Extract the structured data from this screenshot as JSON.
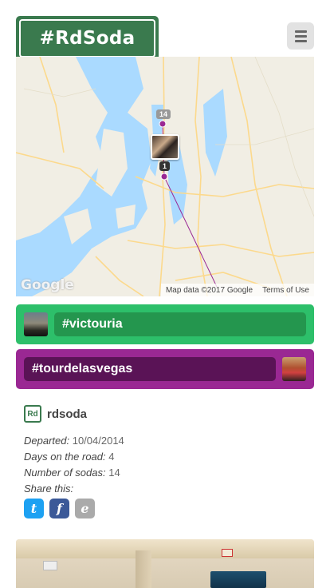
{
  "header": {
    "logo_text": "#RdSoda",
    "menu_icon": "hamburger-icon"
  },
  "map": {
    "badge_top": "14",
    "badge_bottom": "1",
    "google_logo": "Google",
    "attribution": "Map data ©2017 Google",
    "terms": "Terms of Use",
    "route_color": "#9a2893"
  },
  "tours": [
    {
      "label": "#victouria",
      "color": "#2dbf6a"
    },
    {
      "label": "#tourdelasvegas",
      "color": "#9a2893"
    }
  ],
  "user": {
    "avatar_text": "Rd",
    "name": "rdsoda"
  },
  "meta": {
    "departed_label": "Departed:",
    "departed_value": "10/04/2014",
    "days_label": "Days on the road:",
    "days_value": "4",
    "sodas_label": "Number of sodas:",
    "sodas_value": "14",
    "share_label": "Share this:"
  },
  "share": {
    "twitter": "t",
    "facebook": "f",
    "email": "e"
  }
}
